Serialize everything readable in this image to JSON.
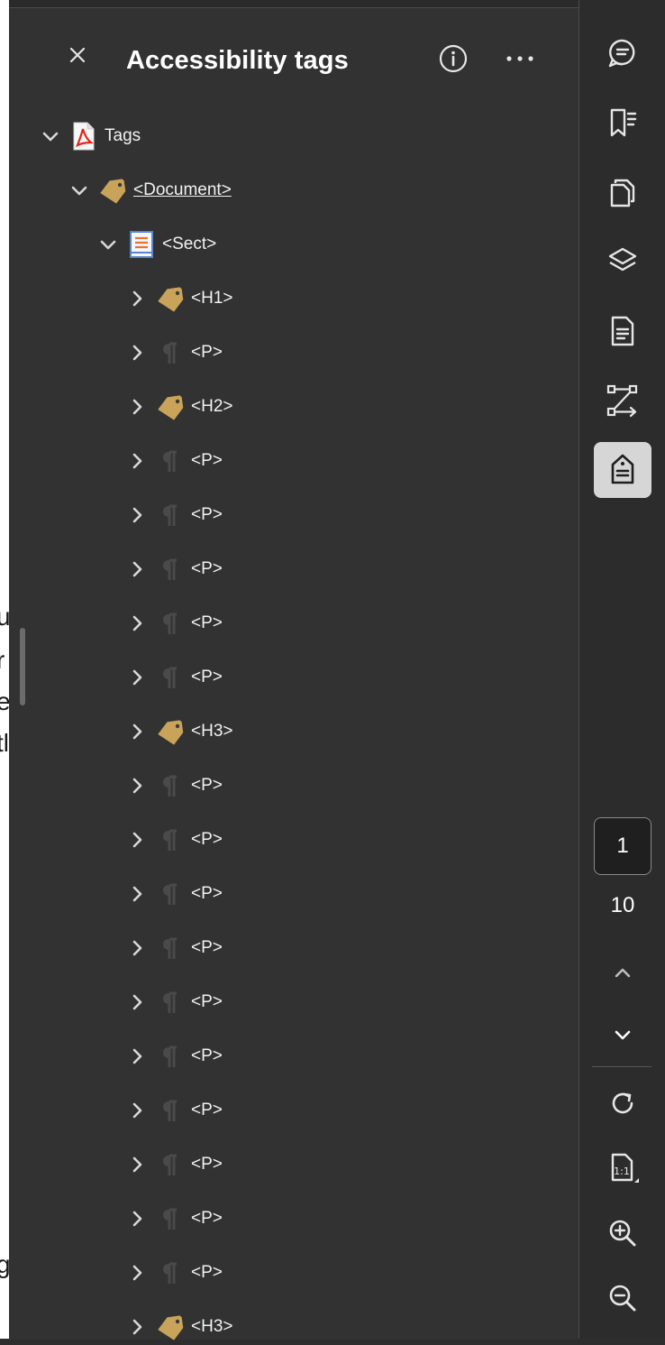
{
  "panel": {
    "title": "Accessibility tags"
  },
  "doc_fragments": [
    "u",
    "r",
    "e",
    "tl",
    "g"
  ],
  "tree": [
    {
      "label": "Tags",
      "level": 0,
      "expanded": true,
      "icon": "pdf-file-icon",
      "underline": false
    },
    {
      "label": "<Document>",
      "level": 1,
      "expanded": true,
      "icon": "tag-icon",
      "underline": true
    },
    {
      "label": "<Sect>",
      "level": 2,
      "expanded": true,
      "icon": "section-icon",
      "underline": false
    },
    {
      "label": "<H1>",
      "level": 3,
      "expanded": false,
      "icon": "tag-icon",
      "underline": false
    },
    {
      "label": "<P>",
      "level": 3,
      "expanded": false,
      "icon": "paragraph-icon",
      "underline": false
    },
    {
      "label": "<H2>",
      "level": 3,
      "expanded": false,
      "icon": "tag-icon",
      "underline": false
    },
    {
      "label": "<P>",
      "level": 3,
      "expanded": false,
      "icon": "paragraph-icon",
      "underline": false
    },
    {
      "label": "<P>",
      "level": 3,
      "expanded": false,
      "icon": "paragraph-icon",
      "underline": false
    },
    {
      "label": "<P>",
      "level": 3,
      "expanded": false,
      "icon": "paragraph-icon",
      "underline": false
    },
    {
      "label": "<P>",
      "level": 3,
      "expanded": false,
      "icon": "paragraph-icon",
      "underline": false
    },
    {
      "label": "<P>",
      "level": 3,
      "expanded": false,
      "icon": "paragraph-icon",
      "underline": false
    },
    {
      "label": "<H3>",
      "level": 3,
      "expanded": false,
      "icon": "tag-icon",
      "underline": false
    },
    {
      "label": "<P>",
      "level": 3,
      "expanded": false,
      "icon": "paragraph-icon",
      "underline": false
    },
    {
      "label": "<P>",
      "level": 3,
      "expanded": false,
      "icon": "paragraph-icon",
      "underline": false
    },
    {
      "label": "<P>",
      "level": 3,
      "expanded": false,
      "icon": "paragraph-icon",
      "underline": false
    },
    {
      "label": "<P>",
      "level": 3,
      "expanded": false,
      "icon": "paragraph-icon",
      "underline": false
    },
    {
      "label": "<P>",
      "level": 3,
      "expanded": false,
      "icon": "paragraph-icon",
      "underline": false
    },
    {
      "label": "<P>",
      "level": 3,
      "expanded": false,
      "icon": "paragraph-icon",
      "underline": false
    },
    {
      "label": "<P>",
      "level": 3,
      "expanded": false,
      "icon": "paragraph-icon",
      "underline": false
    },
    {
      "label": "<P>",
      "level": 3,
      "expanded": false,
      "icon": "paragraph-icon",
      "underline": false
    },
    {
      "label": "<P>",
      "level": 3,
      "expanded": false,
      "icon": "paragraph-icon",
      "underline": false
    },
    {
      "label": "<P>",
      "level": 3,
      "expanded": false,
      "icon": "paragraph-icon",
      "underline": false
    },
    {
      "label": "<H3>",
      "level": 3,
      "expanded": false,
      "icon": "tag-icon",
      "underline": false
    }
  ],
  "rail": {
    "tools": [
      {
        "icon": "comment-icon",
        "active": false
      },
      {
        "icon": "bookmark-icon",
        "active": false
      },
      {
        "icon": "pages-icon",
        "active": false
      },
      {
        "icon": "layers-icon",
        "active": false
      },
      {
        "icon": "document-icon",
        "active": false
      },
      {
        "icon": "order-icon",
        "active": false
      },
      {
        "icon": "accessibility-tag-icon",
        "active": true
      }
    ],
    "current_page": "1",
    "total_pages": "10"
  },
  "colors": {
    "panel_bg": "#323232",
    "rail_bg": "#2c2c2c",
    "tag_gold": "#c9a35a",
    "active_tool_bg": "#d6d6d6",
    "pdf_red": "#e0251b"
  }
}
